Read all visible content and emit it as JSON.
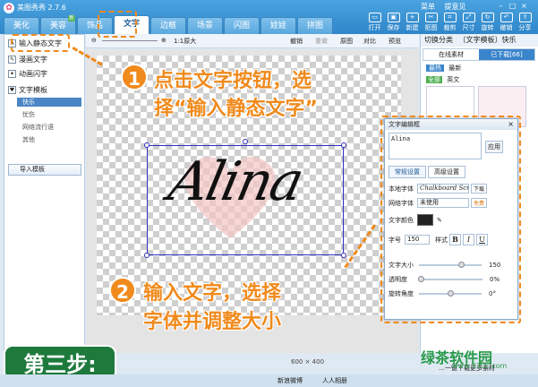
{
  "app": {
    "title": "美图秀秀 2.7.6",
    "top_links": [
      "菜单",
      "提意见"
    ]
  },
  "tabs": [
    "美化",
    "美容",
    "饰品",
    "文字",
    "边框",
    "场景",
    "闪图",
    "娃娃",
    "拼图"
  ],
  "tab_badge": "新",
  "tools": [
    "打开",
    "保存",
    "新建",
    "抠图",
    "裁剪",
    "尺寸",
    "旋转",
    "撤销",
    "分享"
  ],
  "toolbar2": {
    "zoom": "1:1原大",
    "undo": "撤销",
    "redo": "重做",
    "original": "原图",
    "compare": "对比",
    "preview": "预览"
  },
  "left_panel": {
    "input_static": "输入静态文字",
    "comic_text": "漫画文字",
    "animated_text": "动画闪字",
    "template": "文字模板",
    "subs": [
      "快乐",
      "忧伤",
      "网络流行语",
      "其他"
    ],
    "import": "导入模板"
  },
  "right_panel": {
    "category": "切换分类",
    "category_value": "〔文字模板〕快乐",
    "online": "在线素材",
    "downloaded": "已下载[66]",
    "hot": "最热",
    "newest": "最新",
    "all": "全部",
    "english": "英文"
  },
  "canvas": {
    "text": "Alina",
    "size_label": "600 × 400"
  },
  "dialog": {
    "title": "文字编辑框",
    "input_value": "Alina",
    "apply": "应用",
    "tab_normal": "常规设置",
    "tab_advanced": "高级设置",
    "local_font": "本地字体",
    "local_font_value": "Chalkboard Script",
    "download": "下载",
    "web_font": "网络字体",
    "web_font_value": "未使用",
    "free": "免费",
    "text_color": "文字颜色",
    "font_size": "字号",
    "font_size_value": "150",
    "style": "样式",
    "size_label": "文字大小",
    "size_value": "150",
    "opacity_label": "透明度",
    "opacity_value": "0%",
    "rotate_label": "旋转角度",
    "rotate_value": "0°"
  },
  "callouts": {
    "step1_num": "1",
    "step1_line1": "点击文字按钮，选",
    "step1_line2": "择“输入静态文字”",
    "step2_num": "2",
    "step2_line1": "输入文字，选择",
    "step2_line2": "字体并调整大小",
    "step_label": "第三步:"
  },
  "bottom": {
    "weibo": "新浪微博",
    "renren": "人人相册",
    "more": "…一键下载更多素材",
    "watermark": "绿茶软件园",
    "url": "www.33LC.com"
  },
  "colors": {
    "accent": "#f08a1c",
    "title_bar": "#2f86c9",
    "step_bg": "#1d7a3c"
  }
}
